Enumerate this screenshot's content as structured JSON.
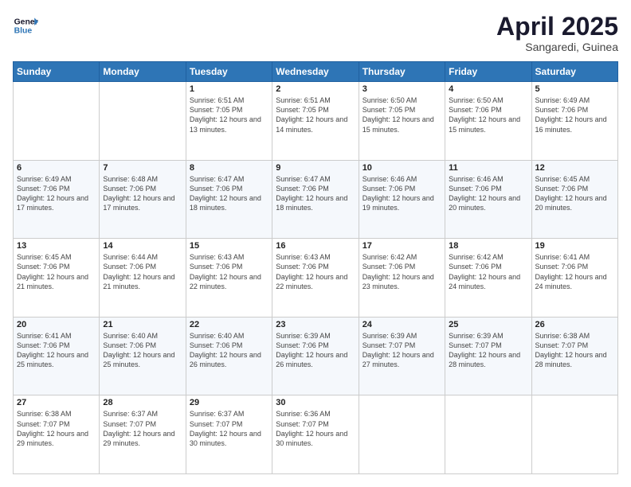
{
  "logo": {
    "line1": "General",
    "line2": "Blue"
  },
  "title": "April 2025",
  "location": "Sangaredi, Guinea",
  "days_of_week": [
    "Sunday",
    "Monday",
    "Tuesday",
    "Wednesday",
    "Thursday",
    "Friday",
    "Saturday"
  ],
  "weeks": [
    [
      {
        "day": "",
        "info": ""
      },
      {
        "day": "",
        "info": ""
      },
      {
        "day": "1",
        "info": "Sunrise: 6:51 AM\nSunset: 7:05 PM\nDaylight: 12 hours and 13 minutes."
      },
      {
        "day": "2",
        "info": "Sunrise: 6:51 AM\nSunset: 7:05 PM\nDaylight: 12 hours and 14 minutes."
      },
      {
        "day": "3",
        "info": "Sunrise: 6:50 AM\nSunset: 7:05 PM\nDaylight: 12 hours and 15 minutes."
      },
      {
        "day": "4",
        "info": "Sunrise: 6:50 AM\nSunset: 7:06 PM\nDaylight: 12 hours and 15 minutes."
      },
      {
        "day": "5",
        "info": "Sunrise: 6:49 AM\nSunset: 7:06 PM\nDaylight: 12 hours and 16 minutes."
      }
    ],
    [
      {
        "day": "6",
        "info": "Sunrise: 6:49 AM\nSunset: 7:06 PM\nDaylight: 12 hours and 17 minutes."
      },
      {
        "day": "7",
        "info": "Sunrise: 6:48 AM\nSunset: 7:06 PM\nDaylight: 12 hours and 17 minutes."
      },
      {
        "day": "8",
        "info": "Sunrise: 6:47 AM\nSunset: 7:06 PM\nDaylight: 12 hours and 18 minutes."
      },
      {
        "day": "9",
        "info": "Sunrise: 6:47 AM\nSunset: 7:06 PM\nDaylight: 12 hours and 18 minutes."
      },
      {
        "day": "10",
        "info": "Sunrise: 6:46 AM\nSunset: 7:06 PM\nDaylight: 12 hours and 19 minutes."
      },
      {
        "day": "11",
        "info": "Sunrise: 6:46 AM\nSunset: 7:06 PM\nDaylight: 12 hours and 20 minutes."
      },
      {
        "day": "12",
        "info": "Sunrise: 6:45 AM\nSunset: 7:06 PM\nDaylight: 12 hours and 20 minutes."
      }
    ],
    [
      {
        "day": "13",
        "info": "Sunrise: 6:45 AM\nSunset: 7:06 PM\nDaylight: 12 hours and 21 minutes."
      },
      {
        "day": "14",
        "info": "Sunrise: 6:44 AM\nSunset: 7:06 PM\nDaylight: 12 hours and 21 minutes."
      },
      {
        "day": "15",
        "info": "Sunrise: 6:43 AM\nSunset: 7:06 PM\nDaylight: 12 hours and 22 minutes."
      },
      {
        "day": "16",
        "info": "Sunrise: 6:43 AM\nSunset: 7:06 PM\nDaylight: 12 hours and 22 minutes."
      },
      {
        "day": "17",
        "info": "Sunrise: 6:42 AM\nSunset: 7:06 PM\nDaylight: 12 hours and 23 minutes."
      },
      {
        "day": "18",
        "info": "Sunrise: 6:42 AM\nSunset: 7:06 PM\nDaylight: 12 hours and 24 minutes."
      },
      {
        "day": "19",
        "info": "Sunrise: 6:41 AM\nSunset: 7:06 PM\nDaylight: 12 hours and 24 minutes."
      }
    ],
    [
      {
        "day": "20",
        "info": "Sunrise: 6:41 AM\nSunset: 7:06 PM\nDaylight: 12 hours and 25 minutes."
      },
      {
        "day": "21",
        "info": "Sunrise: 6:40 AM\nSunset: 7:06 PM\nDaylight: 12 hours and 25 minutes."
      },
      {
        "day": "22",
        "info": "Sunrise: 6:40 AM\nSunset: 7:06 PM\nDaylight: 12 hours and 26 minutes."
      },
      {
        "day": "23",
        "info": "Sunrise: 6:39 AM\nSunset: 7:06 PM\nDaylight: 12 hours and 26 minutes."
      },
      {
        "day": "24",
        "info": "Sunrise: 6:39 AM\nSunset: 7:07 PM\nDaylight: 12 hours and 27 minutes."
      },
      {
        "day": "25",
        "info": "Sunrise: 6:39 AM\nSunset: 7:07 PM\nDaylight: 12 hours and 28 minutes."
      },
      {
        "day": "26",
        "info": "Sunrise: 6:38 AM\nSunset: 7:07 PM\nDaylight: 12 hours and 28 minutes."
      }
    ],
    [
      {
        "day": "27",
        "info": "Sunrise: 6:38 AM\nSunset: 7:07 PM\nDaylight: 12 hours and 29 minutes."
      },
      {
        "day": "28",
        "info": "Sunrise: 6:37 AM\nSunset: 7:07 PM\nDaylight: 12 hours and 29 minutes."
      },
      {
        "day": "29",
        "info": "Sunrise: 6:37 AM\nSunset: 7:07 PM\nDaylight: 12 hours and 30 minutes."
      },
      {
        "day": "30",
        "info": "Sunrise: 6:36 AM\nSunset: 7:07 PM\nDaylight: 12 hours and 30 minutes."
      },
      {
        "day": "",
        "info": ""
      },
      {
        "day": "",
        "info": ""
      },
      {
        "day": "",
        "info": ""
      }
    ]
  ]
}
